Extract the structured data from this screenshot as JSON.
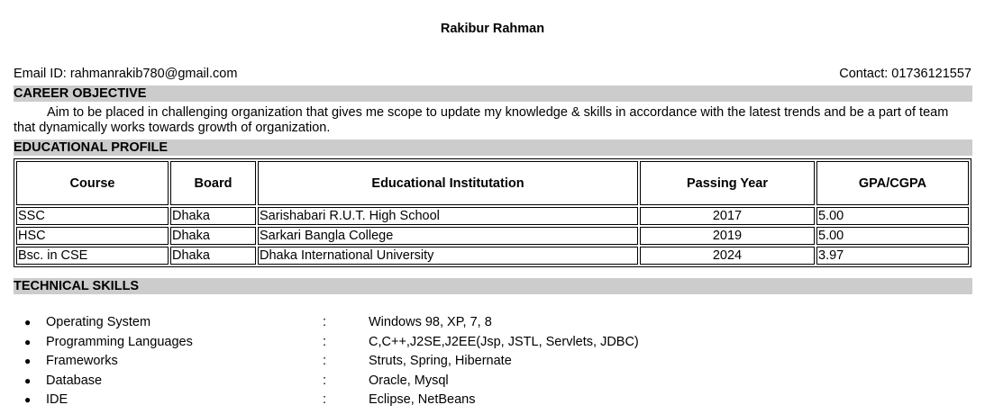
{
  "header": {
    "name": "Rakibur Rahman",
    "email": "Email ID: rahmanrakib780@gmail.com",
    "contact": "Contact: 01736121557"
  },
  "sections": {
    "career": "CAREER OBJECTIVE",
    "education": "EDUCATIONAL PROFILE",
    "skills": "TECHNICAL SKILLS"
  },
  "objective": "Aim to be placed in challenging organization that gives me scope to update my knowledge & skills in accordance with the latest trends and be a part of team that dynamically works towards growth of organization.",
  "education": {
    "headers": [
      "Course",
      "Board",
      "Educational Institutation",
      "Passing Year",
      "GPA/CGPA"
    ],
    "rows": [
      [
        "SSC",
        "Dhaka",
        "Sarishabari R.U.T. High School",
        "2017",
        "5.00"
      ],
      [
        "HSC",
        "Dhaka",
        "Sarkari Bangla College",
        "2019",
        "5.00"
      ],
      [
        "Bsc. in CSE",
        "Dhaka",
        "Dhaka International University",
        "2024",
        "3.97"
      ]
    ]
  },
  "skills": [
    {
      "key": "Operating System",
      "sep": ":",
      "value": "Windows 98, XP, 7, 8"
    },
    {
      "key": "Programming Languages",
      "sep": ":",
      "value": "C,C++,J2SE,J2EE(Jsp, JSTL, Servlets, JDBC)"
    },
    {
      "key": "Frameworks",
      "sep": ":",
      "value": "Struts, Spring, Hibernate"
    },
    {
      "key": "Database",
      "sep": ":",
      "value": "Oracle, Mysql"
    },
    {
      "key": "IDE",
      "sep": ":",
      "value": "Eclipse, NetBeans"
    }
  ]
}
